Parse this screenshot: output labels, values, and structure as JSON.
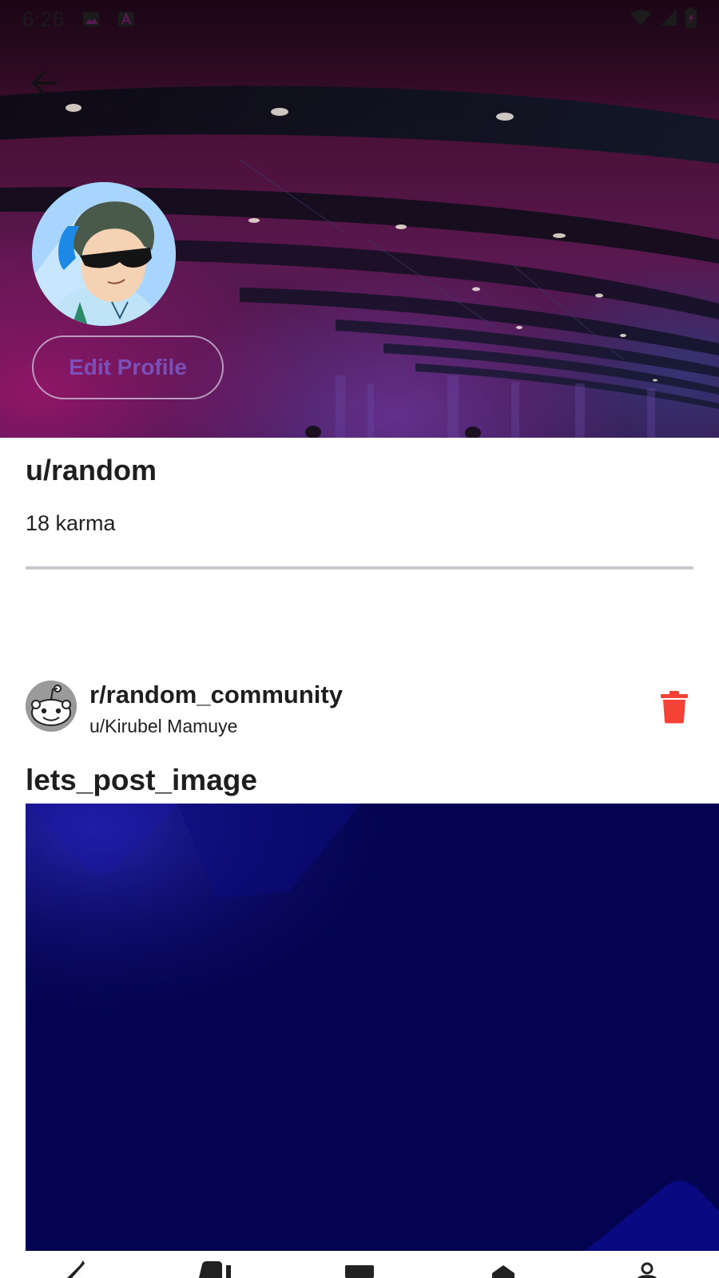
{
  "status_bar": {
    "time": "6:26",
    "left_icons": [
      "image-icon",
      "text-a-icon"
    ],
    "right_icons": [
      "wifi-icon",
      "cellular-icon",
      "battery-icon"
    ]
  },
  "header": {
    "back_icon": "arrow-back-icon"
  },
  "profile": {
    "edit_label": "Edit Profile",
    "username": "u/random",
    "karma": "18 karma"
  },
  "post": {
    "community": "r/random_community",
    "author": "u/Kirubel Mamuye",
    "title": "lets_post_image",
    "delete_icon": "trash-icon"
  },
  "bottom_nav": {
    "items": [
      "edit-icon",
      "chat-icon",
      "inbox-icon",
      "home-icon",
      "profile-icon"
    ]
  },
  "colors": {
    "accent": "#7b4fb8",
    "delete": "#f44336",
    "image_bg": "#04034f"
  }
}
